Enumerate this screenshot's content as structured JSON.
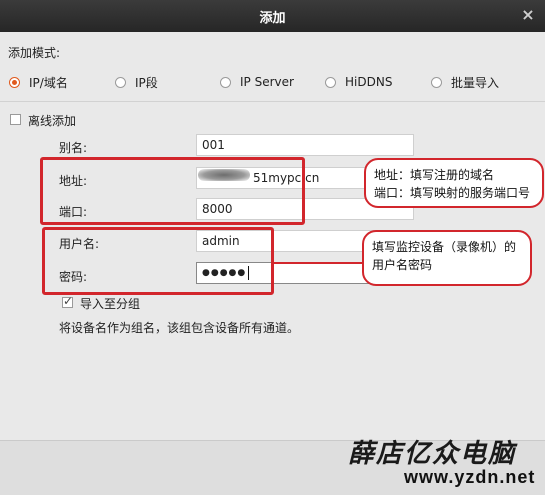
{
  "dialog": {
    "title": "添加",
    "close_glyph": "×"
  },
  "add_mode": {
    "label": "添加模式:",
    "options": [
      {
        "label": "IP/域名",
        "selected": true
      },
      {
        "label": "IP段",
        "selected": false
      },
      {
        "label": "IP Server",
        "selected": false
      },
      {
        "label": "HiDDNS",
        "selected": false
      },
      {
        "label": "批量导入",
        "selected": false
      }
    ]
  },
  "offline_add": {
    "label": "离线添加",
    "checked": false
  },
  "form": {
    "alias": {
      "label": "别名:",
      "value": "001"
    },
    "address": {
      "label": "地址:",
      "value": "51mypc.cn"
    },
    "port": {
      "label": "端口:",
      "value": "8000"
    },
    "username": {
      "label": "用户名:",
      "value": "admin"
    },
    "password": {
      "label": "密码:",
      "value": "●●●●●"
    }
  },
  "import_group": {
    "label": "导入至分组",
    "checked": true
  },
  "group_hint": "将设备名作为组名，该组包含设备所有通道。",
  "callouts": {
    "address_port": {
      "line1": "地址：填写注册的域名",
      "line2": "端口：填写映射的服务端口号"
    },
    "credentials": {
      "line1": "填写监控设备（录像机）的",
      "line2": "用户名密码"
    }
  },
  "watermark": {
    "name": "薛店亿众电脑",
    "url": "www.yzdn.net"
  },
  "colors": {
    "annotation_red": "#d2262c",
    "radio_accent": "#e05a1e"
  }
}
